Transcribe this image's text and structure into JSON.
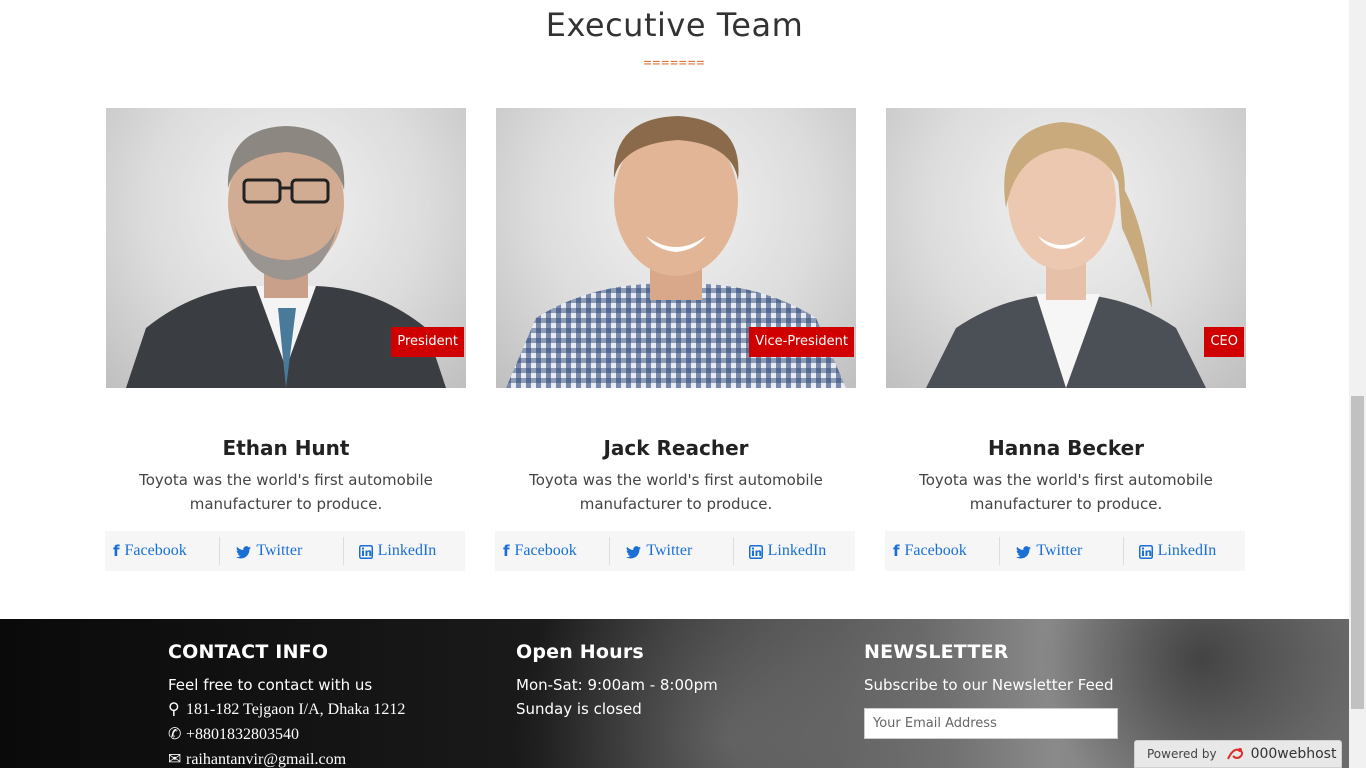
{
  "section": {
    "title": "Executive Team",
    "divider": "======="
  },
  "team": [
    {
      "name": "Ethan Hunt",
      "role": "President",
      "description": "Toyota was the world's first automobile manufacturer to produce.",
      "links": {
        "facebook": "Facebook",
        "twitter": "Twitter",
        "linkedin": "LinkedIn"
      }
    },
    {
      "name": "Jack Reacher",
      "role": "Vice-President",
      "description": "Toyota was the world's first automobile manufacturer to produce.",
      "links": {
        "facebook": "Facebook",
        "twitter": "Twitter",
        "linkedin": "LinkedIn"
      }
    },
    {
      "name": "Hanna Becker",
      "role": "CEO",
      "description": "Toyota was the world's first automobile manufacturer to produce.",
      "links": {
        "facebook": "Facebook",
        "twitter": "Twitter",
        "linkedin": "LinkedIn"
      }
    }
  ],
  "footer": {
    "contact": {
      "heading": "CONTACT INFO",
      "intro": "Feel free to contact with us",
      "address": "181-182 Tejgaon I/A, Dhaka 1212",
      "phone": "+8801832803540",
      "email": "raihantanvir@gmail.com"
    },
    "hours": {
      "heading": "Open Hours",
      "weekdays": "Mon-Sat: 9:00am - 8:00pm",
      "sunday": "Sunday is closed"
    },
    "newsletter": {
      "heading": "NEWSLETTER",
      "subtitle": "Subscribe to our Newsletter Feed",
      "placeholder": "Your Email Address"
    }
  },
  "host_badge": {
    "prefix": "Powered by",
    "brand": "000webhost"
  },
  "colors": {
    "accent_red": "#d10000",
    "link_blue": "#1a6fd6",
    "divider_orange": "#e0763b",
    "subscribe_green": "#1e9e4e"
  },
  "icons": [
    "facebook-icon",
    "twitter-icon",
    "linkedin-icon",
    "map-marker-icon",
    "phone-icon",
    "envelope-icon",
    "000webhost-logo-icon"
  ]
}
